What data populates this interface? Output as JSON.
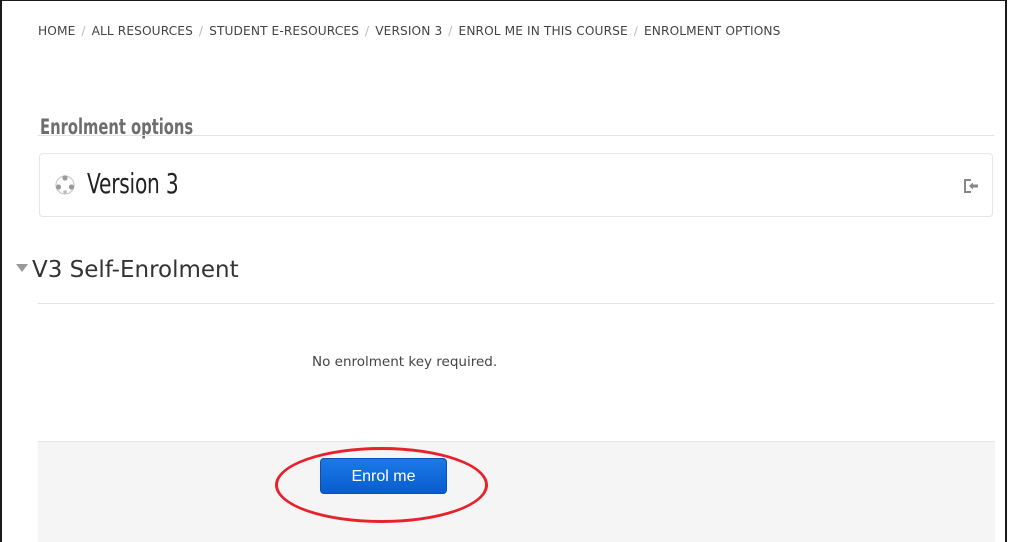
{
  "breadcrumb": {
    "items": [
      "HOME",
      "ALL RESOURCES",
      "STUDENT E-RESOURCES",
      "VERSION 3",
      "ENROL ME IN THIS COURSE",
      "ENROLMENT OPTIONS"
    ],
    "separator": "/"
  },
  "page": {
    "title": "Enrolment options"
  },
  "course": {
    "name": "Version 3",
    "icon": "course-icon",
    "action_icon": "enter-course-icon"
  },
  "enrolment_section": {
    "title": "V3 Self-Enrolment",
    "icon": "collapse-caret-icon",
    "info": "No enrolment key required.",
    "button_label": "Enrol me"
  },
  "colors": {
    "button": "#0a5ccf",
    "highlight": "#e8212a",
    "action_bg": "#f5f5f5"
  }
}
